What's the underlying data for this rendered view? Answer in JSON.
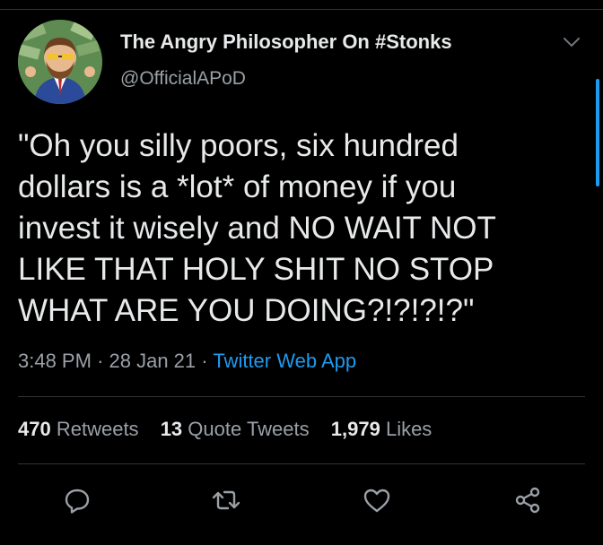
{
  "tweet": {
    "display_name": "The Angry Philosopher On #Stonks",
    "handle": "@OfficialAPoD",
    "text_lines": [
      "\"Oh you silly poors, six hundred",
      "dollars is a *lot* of money if you",
      "invest it wisely and NO WAIT NOT",
      "LIKE THAT HOLY SHIT NO STOP",
      "WHAT ARE YOU DOING?!?!?!?\""
    ],
    "time": "3:48 PM",
    "date": "28 Jan 21",
    "separator": "·",
    "source_app": "Twitter Web App"
  },
  "stats": {
    "retweets_count": "470",
    "retweets_label": "Retweets",
    "quotes_count": "13",
    "quotes_label": "Quote Tweets",
    "likes_count": "1,979",
    "likes_label": "Likes"
  },
  "colors": {
    "background": "#000000",
    "text_primary": "#e7e9ea",
    "text_secondary": "#9aa0a6",
    "accent": "#1d9bf0",
    "divider": "#2f3336"
  },
  "icons": {
    "reply": "reply-icon",
    "retweet": "retweet-icon",
    "like": "heart-icon",
    "share": "share-icon",
    "more": "chevron-down-icon"
  }
}
